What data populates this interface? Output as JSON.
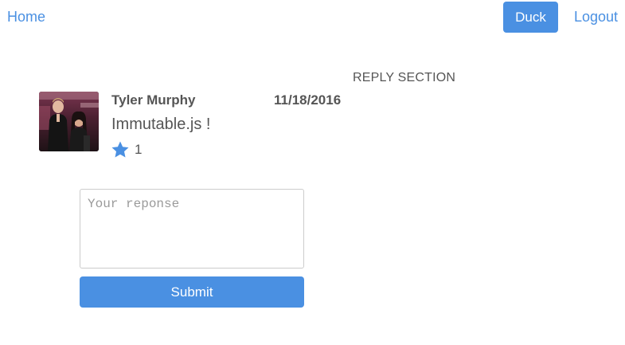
{
  "nav": {
    "home_label": "Home",
    "duck_label": "Duck",
    "logout_label": "Logout"
  },
  "reply_section": {
    "header": "REPLY SECTION"
  },
  "post": {
    "author": "Tyler Murphy",
    "date": "11/18/2016",
    "text": "Immutable.js !",
    "likes": "1",
    "like_icon": "star-icon"
  },
  "reply_form": {
    "placeholder": "Your reponse",
    "value": "",
    "submit_label": "Submit"
  },
  "colors": {
    "accent": "#4a90e2",
    "text": "#555555",
    "border": "#cccccc"
  }
}
